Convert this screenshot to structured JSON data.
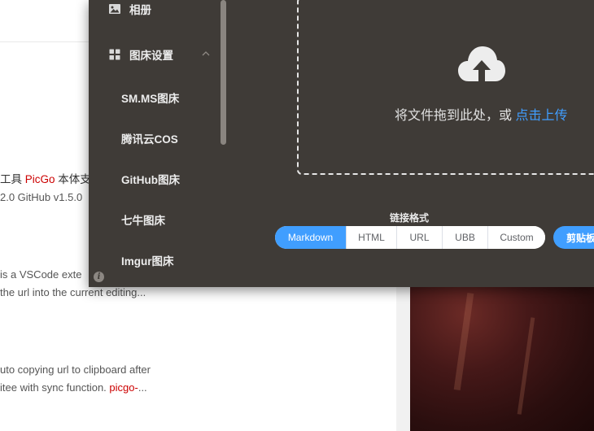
{
  "background": {
    "lines": [
      {
        "pre": "工具 ",
        "link": "PicGo",
        "post": " 本体支"
      },
      {
        "pre": "2.0 GitHub v1.5.0",
        "link": "",
        "post": ""
      },
      {
        "pre": "is a VSCode exte",
        "link": "",
        "post": ""
      },
      {
        "pre": "the url into the current editing...",
        "link": "",
        "post": ""
      },
      {
        "pre": "uto copying url to clipboard after",
        "link": "",
        "post": ""
      },
      {
        "pre": "itee with sync function. ",
        "link": "picgo-",
        "post": "..."
      }
    ]
  },
  "sidebar": {
    "album_label": "相册",
    "picbed_settings_label": "图床设置",
    "items": [
      {
        "label": "SM.MS图床"
      },
      {
        "label": "腾讯云COS"
      },
      {
        "label": "GitHub图床"
      },
      {
        "label": "七牛图床"
      },
      {
        "label": "Imgur图床"
      }
    ],
    "info_icon_glyph": "i"
  },
  "upload": {
    "text": "将文件拖到此处，或 ",
    "link": "点击上传"
  },
  "link_format": {
    "title": "链接格式",
    "options": [
      "Markdown",
      "HTML",
      "URL",
      "UBB",
      "Custom"
    ],
    "selected": "Markdown"
  },
  "clipboard_button_label": "剪贴板上传",
  "colors": {
    "window_bg": "#3f3b37",
    "accent": "#409eff",
    "bg_link": "#cc0000"
  },
  "icons": {
    "album": "image-icon",
    "settings": "grid-icon",
    "expand": "chevron-up-icon",
    "upload": "cloud-upload-icon",
    "info": "info-icon"
  }
}
